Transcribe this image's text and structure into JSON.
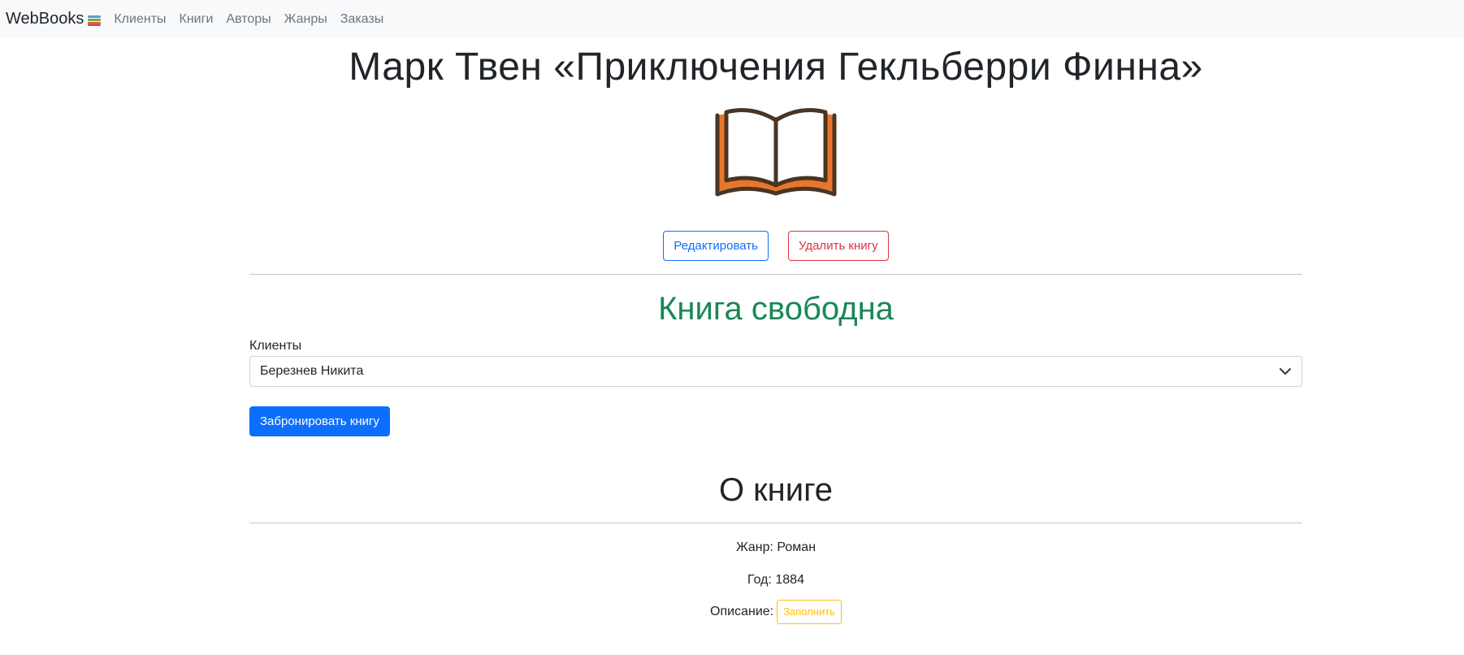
{
  "navbar": {
    "brand": "WebBooks",
    "brand_icon": "books-icon",
    "links": [
      "Клиенты",
      "Книги",
      "Авторы",
      "Жанры",
      "Заказы"
    ]
  },
  "book": {
    "title": "Марк Твен «Приключения Гекльберри Финна»",
    "cover_icon": "open-book-icon",
    "edit_label": "Редактировать",
    "delete_label": "Удалить книгу"
  },
  "reservation": {
    "status": "Книга свободна",
    "clients_label": "Клиенты",
    "selected_client": "Березнев Никита",
    "reserve_label": "Забронировать книгу"
  },
  "about": {
    "heading": "О книге",
    "genre": "Жанр: Роман",
    "year": "Год: 1884",
    "description_label": "Описание:",
    "fill_label": "Заполнить"
  },
  "colors": {
    "primary": "#0d6efd",
    "danger": "#dc3545",
    "success": "#198754",
    "warning": "#ffc107",
    "book_orange": "#e8762b",
    "book_outline": "#4a3424"
  }
}
